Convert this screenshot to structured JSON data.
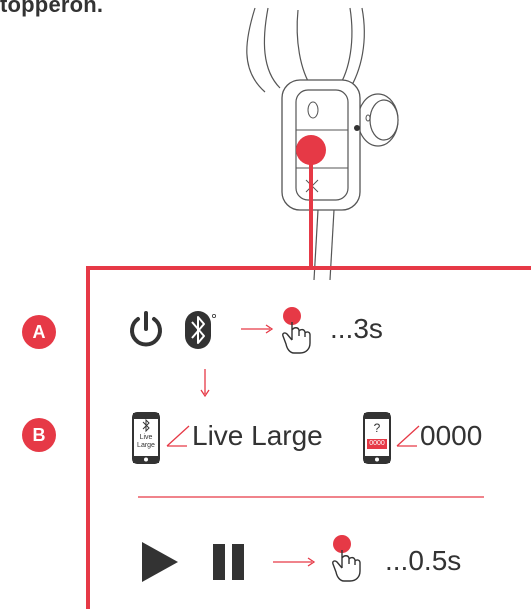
{
  "header": {
    "partial_text": "topperon."
  },
  "steps": [
    {
      "badge": "A",
      "duration": "...3s"
    },
    {
      "badge": "B",
      "device_name": "Live Large",
      "phone_label_lines": [
        "Live",
        "Large"
      ],
      "pin_code": "0000",
      "phone_pin_label": "0000",
      "phone_question": "?"
    }
  ],
  "play_pause": {
    "duration": "...0.5s"
  },
  "colors": {
    "accent": "#e63946",
    "dark": "#333333",
    "line_gray": "#555555"
  },
  "icons": [
    "power-icon",
    "bluetooth-icon",
    "tap-hand-icon",
    "phone-icon",
    "play-icon",
    "pause-icon",
    "earphone-illustration"
  ]
}
